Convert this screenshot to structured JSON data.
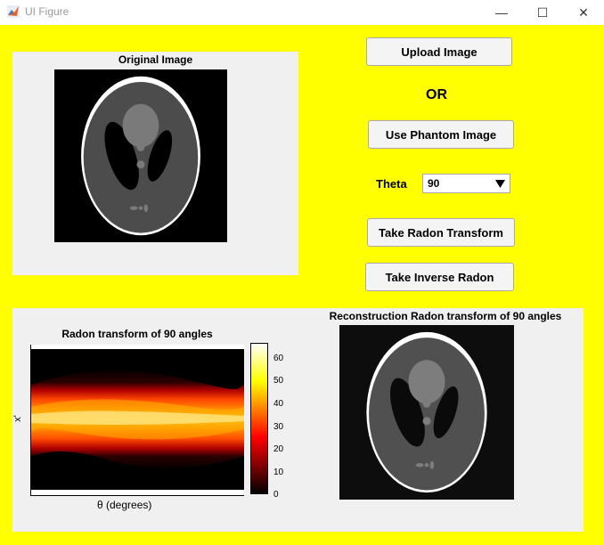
{
  "window": {
    "title": "UI Figure",
    "minimize_glyph": "—",
    "maximize_glyph": "☐",
    "close_glyph": "✕"
  },
  "colors": {
    "background": "#ffff00",
    "panel": "#f0f0f0"
  },
  "original_panel": {
    "title": "Original Image"
  },
  "controls": {
    "upload_label": "Upload Image",
    "or_label": "OR",
    "phantom_label": "Use Phantom Image",
    "theta_label": "Theta",
    "theta_value": "90",
    "radon_label": "Take Radon Transform",
    "inverse_label": "Take Inverse Radon"
  },
  "sinogram": {
    "title": "Radon transform of 90 angles",
    "xlabel": "θ (degrees)",
    "ylabel": "x'",
    "colorbar_ticks": [
      "0",
      "10",
      "20",
      "30",
      "40",
      "50",
      "60"
    ],
    "colormap": "hot"
  },
  "reconstruction": {
    "title": "Reconstruction Radon transform of 90 angles"
  }
}
